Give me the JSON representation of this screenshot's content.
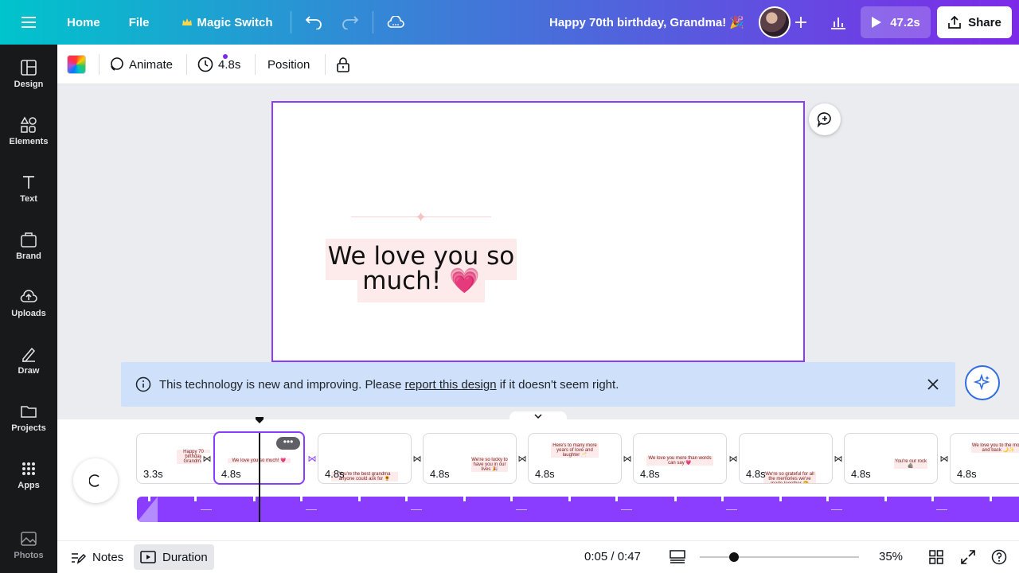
{
  "topbar": {
    "home_label": "Home",
    "file_label": "File",
    "magic_switch_label": "Magic Switch",
    "design_title": "Happy 70th birthday, Grandma! 🎉",
    "play_duration": "47.2s",
    "share_label": "Share",
    "icons": [
      "menu-icon",
      "crown-icon",
      "undo-icon",
      "redo-icon",
      "cloud-save-icon",
      "plus-icon",
      "stats-icon",
      "play-icon",
      "share-icon"
    ]
  },
  "sidebar": {
    "items": [
      {
        "label": "Design",
        "icon": "layout-icon"
      },
      {
        "label": "Elements",
        "icon": "shapes-icon"
      },
      {
        "label": "Text",
        "icon": "text-icon"
      },
      {
        "label": "Brand",
        "icon": "brand-icon"
      },
      {
        "label": "Uploads",
        "icon": "upload-icon"
      },
      {
        "label": "Draw",
        "icon": "draw-icon"
      },
      {
        "label": "Projects",
        "icon": "folder-icon"
      },
      {
        "label": "Apps",
        "icon": "apps-icon"
      },
      {
        "label": "Photos",
        "icon": "photo-icon"
      }
    ]
  },
  "toolbar": {
    "animate_label": "Animate",
    "duration_label": "4.8s",
    "position_label": "Position"
  },
  "canvas": {
    "headline_line1": "We love you so",
    "headline_line2": "much! 💗"
  },
  "banner": {
    "text_before": "This technology is new and improving. Please",
    "link_text": "report this design",
    "text_after": "if it doesn't seem right."
  },
  "timeline": {
    "scenes": [
      {
        "duration": "3.3s",
        "preview": "Happy 70 birthday Grandma"
      },
      {
        "duration": "4.8s",
        "preview": "We love you so much! 💗"
      },
      {
        "duration": "4.8s",
        "preview": "You're the best grandma anyone could ask for 🌻"
      },
      {
        "duration": "4.8s",
        "preview": "We're so lucky to have you in our lives 🎉"
      },
      {
        "duration": "4.8s",
        "preview": "Here's to many more years of love and laughter 🥂"
      },
      {
        "duration": "4.8s",
        "preview": "We love you more than words can say 💗"
      },
      {
        "duration": "4.8s",
        "preview": "We're so grateful for all the memories we've made together 🤗"
      },
      {
        "duration": "4.8s",
        "preview": "You're our rock 🪨"
      },
      {
        "duration": "4.8s",
        "preview": "We love you to the moon and back 🌙✨"
      }
    ],
    "more_label": "•••"
  },
  "bottombar": {
    "notes_label": "Notes",
    "duration_label": "Duration",
    "time_display": "0:05 / 0:47",
    "zoom_percent": 35,
    "zoom_label": "35%"
  },
  "colors": {
    "accent": "#8b3dff",
    "sidebar_bg": "#18191b",
    "banner_bg": "#cfe0fb",
    "text_highlight": "#fdeaea"
  }
}
